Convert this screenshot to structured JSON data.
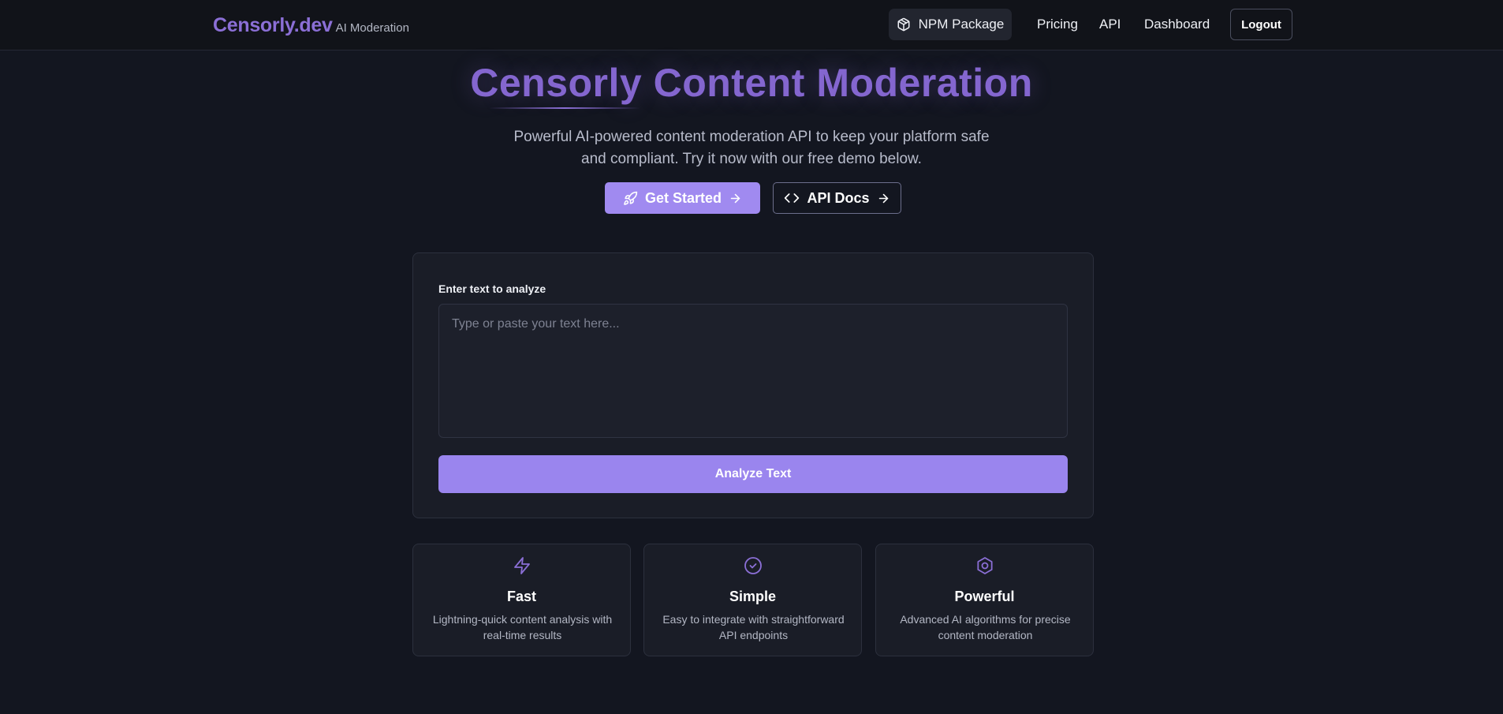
{
  "nav": {
    "brand": "Censorly.dev",
    "tagline": "AI Moderation",
    "npm_label": "NPM Package",
    "links": [
      "Pricing",
      "API",
      "Dashboard"
    ],
    "logout_label": "Logout"
  },
  "hero": {
    "title": "Censorly Content Moderation",
    "subtitle": "Powerful AI-powered content moderation API to keep your platform safe and compliant. Try it now with our free demo below.",
    "primary_button": "Get Started",
    "secondary_button": "API Docs"
  },
  "analyzer": {
    "label": "Enter text to analyze",
    "placeholder": "Type or paste your text here...",
    "button": "Analyze Text"
  },
  "features": [
    {
      "icon": "lightning-icon",
      "title": "Fast",
      "description": "Lightning-quick content analysis with real-time results"
    },
    {
      "icon": "check-circle-icon",
      "title": "Simple",
      "description": "Easy to integrate with straightforward API endpoints"
    },
    {
      "icon": "hexagon-gear-icon",
      "title": "Powerful",
      "description": "Advanced AI algorithms for precise content moderation"
    }
  ],
  "colors": {
    "background": "#131620",
    "accent": "#a08af0",
    "brand": "#8b6fd6",
    "card": "#1a1d27"
  }
}
